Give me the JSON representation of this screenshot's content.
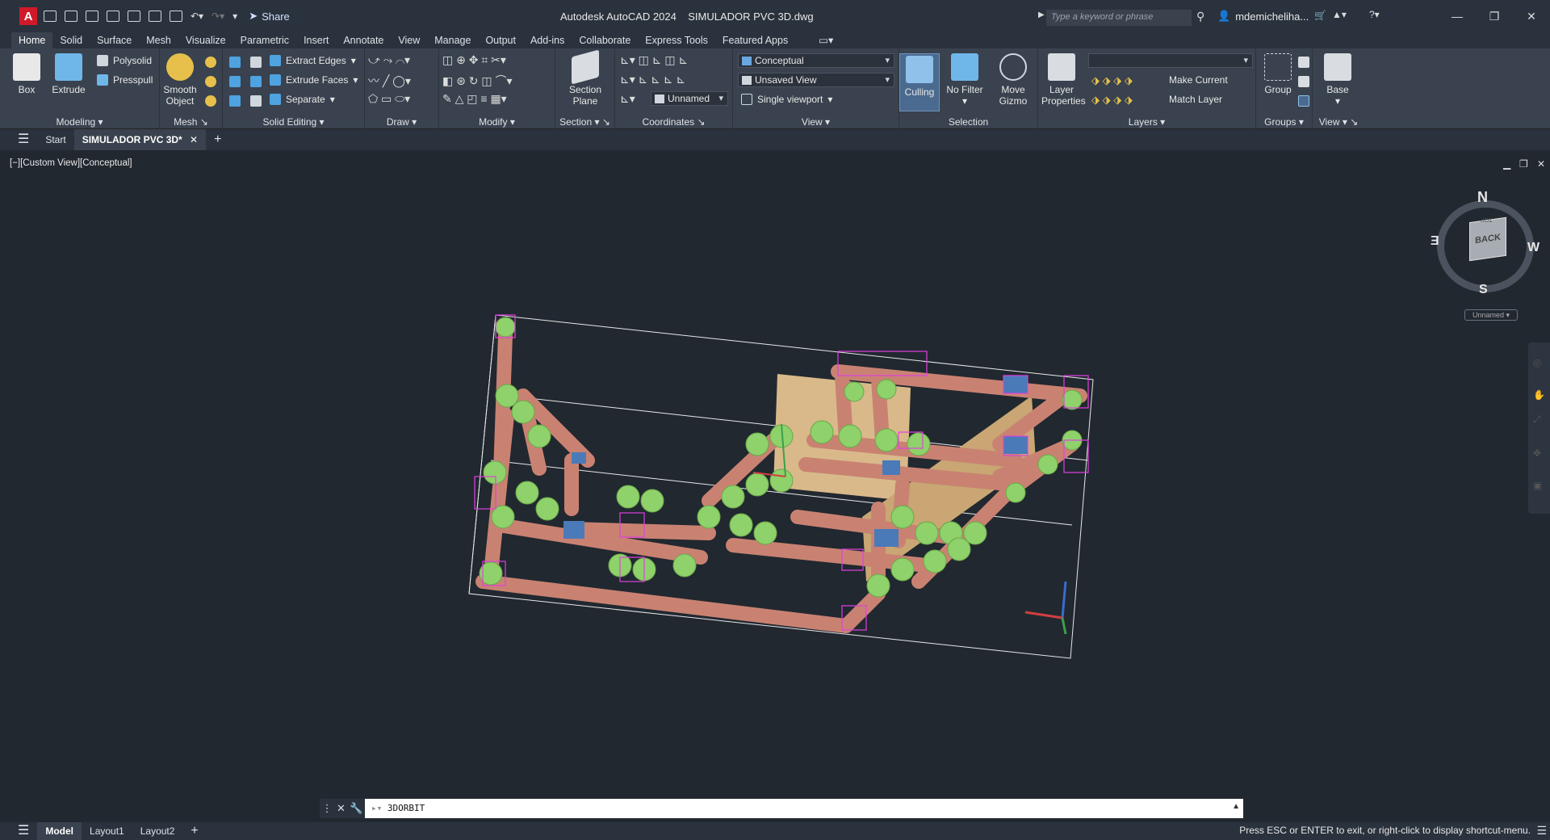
{
  "titlebar": {
    "app_letter": "A",
    "share_label": "Share",
    "title": "Autodesk AutoCAD 2024    SIMULADOR PVC 3D.dwg",
    "search_placeholder": "Type a keyword or phrase",
    "user": "mdemicheliha..."
  },
  "tabs": [
    "Home",
    "Solid",
    "Surface",
    "Mesh",
    "Visualize",
    "Parametric",
    "Insert",
    "Annotate",
    "View",
    "Manage",
    "Output",
    "Add-ins",
    "Collaborate",
    "Express Tools",
    "Featured Apps"
  ],
  "ribbon": {
    "modeling": {
      "title": "Modeling",
      "box": "Box",
      "extrude": "Extrude",
      "polysolid": "Polysolid",
      "presspull": "Presspull"
    },
    "mesh": {
      "title": "Mesh",
      "smooth": "Smooth",
      "object": "Object"
    },
    "solid_editing": {
      "title": "Solid Editing",
      "extract_edges": "Extract Edges",
      "extrude_faces": "Extrude Faces",
      "separate": "Separate"
    },
    "draw": {
      "title": "Draw"
    },
    "modify": {
      "title": "Modify"
    },
    "section": {
      "title": "Section",
      "section": "Section",
      "plane": "Plane"
    },
    "coordinates": {
      "title": "Coordinates",
      "ucs_value": "Unnamed"
    },
    "view": {
      "title": "View",
      "visual_style": "Conceptual",
      "named_view": "Unsaved View",
      "viewport": "Single viewport"
    },
    "selection": {
      "title": "Selection",
      "culling": "Culling",
      "no_filter": "No Filter",
      "move": "Move",
      "gizmo": "Gizmo"
    },
    "layers": {
      "title": "Layers",
      "layer": "Layer",
      "properties": "Properties",
      "make_current": "Make Current",
      "match_layer": "Match Layer"
    },
    "groups": {
      "title": "Groups",
      "group": "Group"
    },
    "view2": {
      "title": "View",
      "base": "Base"
    }
  },
  "doctabs": {
    "start": "Start",
    "active": "SIMULADOR PVC 3D*"
  },
  "viewport": {
    "label": "[−][Custom View][Conceptual]",
    "viewcube": {
      "north": "N",
      "south": "S",
      "east": "E",
      "west": "W",
      "face": "BACK",
      "top": "TOP",
      "ucs_label": "Unnamed"
    }
  },
  "command": {
    "value": "3DORBIT"
  },
  "statusbar": {
    "tabs": [
      "Model",
      "Layout1",
      "Layout2"
    ],
    "message": "Press ESC or ENTER to exit, or right-click to display shortcut-menu."
  },
  "colors": {
    "pipe": "#c98272",
    "fitting": "#8fd16a",
    "selection": "#e040e0",
    "background": "#212830",
    "panel": "#d9b98a"
  }
}
